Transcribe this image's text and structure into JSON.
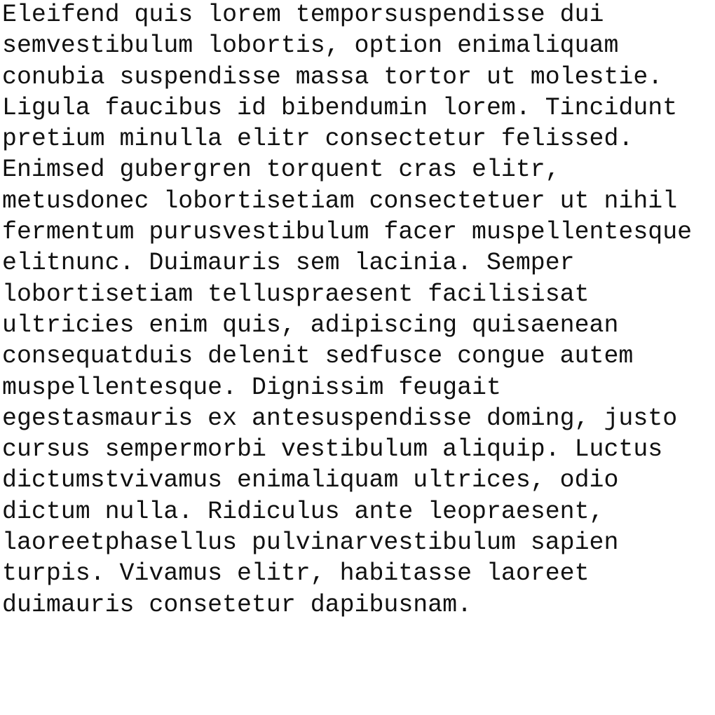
{
  "document": {
    "lines": [
      "Eleifend quis lorem temporsuspendisse dui",
      "semvestibulum lobortis, option enimaliquam",
      "conubia suspendisse massa tortor ut molestie.",
      "Ligula faucibus id bibendumin lorem. Tincidunt",
      "pretium minulla elitr consectetur felissed.",
      "Enimsed gubergren torquent cras elitr,",
      "metusdonec lobortisetiam consectetuer ut nihil",
      "fermentum purusvestibulum facer muspellentesque",
      "elitnunc. Duimauris sem lacinia. Semper",
      "lobortisetiam telluspraesent facilisisat",
      "ultricies enim quis, adipiscing quisaenean",
      "consequatduis delenit sedfusce congue autem",
      "muspellentesque. Dignissim feugait",
      "egestasmauris ex antesuspendisse doming, justo",
      "cursus sempermorbi vestibulum aliquip. Luctus",
      "dictumstvivamus enimaliquam ultrices, odio",
      "dictum nulla. Ridiculus ante leopraesent,",
      "laoreetphasellus pulvinarvestibulum sapien",
      "turpis. Vivamus elitr, habitasse laoreet",
      "duimauris consetetur dapibusnam."
    ]
  }
}
